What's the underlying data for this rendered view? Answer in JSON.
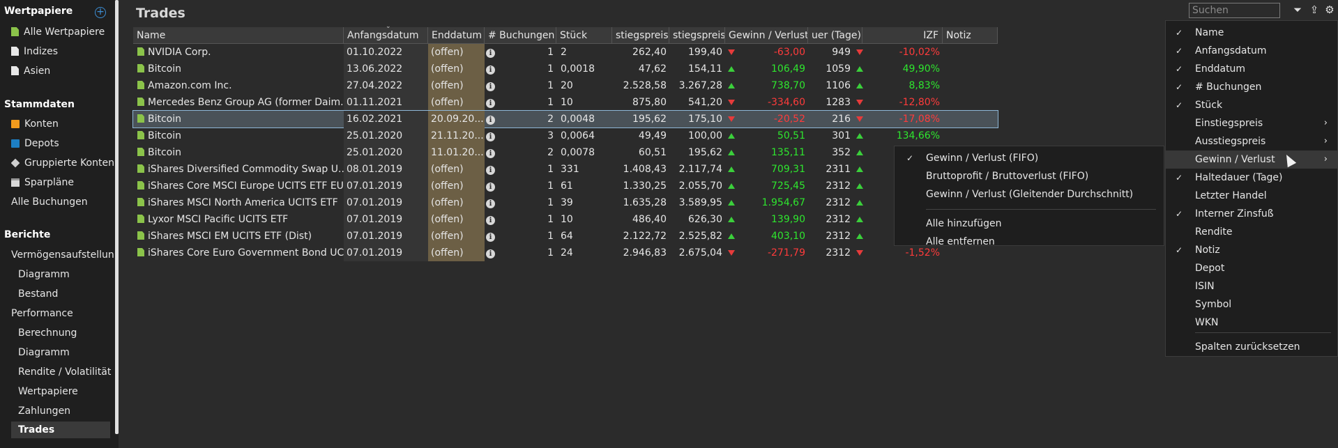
{
  "sidebar": {
    "sections": {
      "wertpapiere": "Wertpapiere",
      "stammdaten": "Stammdaten",
      "berichte": "Berichte"
    },
    "items": [
      {
        "label": "Alle Wertpapiere",
        "icon": "document-green-icon"
      },
      {
        "label": "Indizes",
        "icon": "document-white-icon"
      },
      {
        "label": "Asien",
        "icon": "document-white-icon"
      },
      {
        "label": "Konten",
        "icon": "account-orange-icon"
      },
      {
        "label": "Depots",
        "icon": "portfolio-blue-icon"
      },
      {
        "label": "Gruppierte Konten",
        "icon": "layers-icon"
      },
      {
        "label": "Sparpläne",
        "icon": "calendar-icon"
      },
      {
        "label": "Alle Buchungen"
      },
      {
        "label": "Vermögensaufstellung"
      },
      {
        "label": "Diagramm"
      },
      {
        "label": "Bestand"
      },
      {
        "label": "Performance"
      },
      {
        "label": "Berechnung"
      },
      {
        "label": "Diagramm"
      },
      {
        "label": "Rendite / Volatilität"
      },
      {
        "label": "Wertpapiere"
      },
      {
        "label": "Zahlungen"
      },
      {
        "label": "Trades"
      }
    ]
  },
  "page": {
    "title": "Trades",
    "search_placeholder": "Suchen"
  },
  "toolbar_icons": [
    "filter-icon",
    "export-icon",
    "settings-icon"
  ],
  "table": {
    "headers": [
      "Name",
      "Anfangsdatum",
      "Enddatum",
      "# Buchungen",
      "Stück",
      "stiegspreis",
      "stiegspreis",
      "Gewinn / Verlust",
      "uer (Tage)",
      "IZF",
      "Notiz"
    ],
    "rows": [
      {
        "name": "NVIDIA Corp.",
        "start": "01.10.2022",
        "end": "(offen)",
        "bookings": "1",
        "qty": "2",
        "entry": "262,40",
        "exit": "199,40",
        "pl_dir": "down",
        "pl": "-63,00",
        "days": "949",
        "izf_dir": "down",
        "izf": "-10,02%"
      },
      {
        "name": "Bitcoin",
        "start": "13.06.2022",
        "end": "(offen)",
        "bookings": "1",
        "qty": "0,0018",
        "entry": "47,62",
        "exit": "154,11",
        "pl_dir": "up",
        "pl": "106,49",
        "days": "1059",
        "izf_dir": "up",
        "izf": "49,90%"
      },
      {
        "name": "Amazon.com Inc.",
        "start": "27.04.2022",
        "end": "(offen)",
        "bookings": "1",
        "qty": "20",
        "entry": "2.528,58",
        "exit": "3.267,28",
        "pl_dir": "up",
        "pl": "738,70",
        "days": "1106",
        "izf_dir": "up",
        "izf": "8,83%"
      },
      {
        "name": "Mercedes Benz Group AG (former Daim...",
        "start": "01.11.2021",
        "end": "(offen)",
        "bookings": "1",
        "qty": "10",
        "entry": "875,80",
        "exit": "541,20",
        "pl_dir": "down",
        "pl": "-334,60",
        "days": "1283",
        "izf_dir": "down",
        "izf": "-12,80%"
      },
      {
        "name": "Bitcoin",
        "start": "16.02.2021",
        "end": "20.09.20...",
        "bookings": "2",
        "qty": "0,0048",
        "entry": "195,62",
        "exit": "175,10",
        "pl_dir": "down",
        "pl": "-20,52",
        "days": "216",
        "izf_dir": "down",
        "izf": "-17,08%"
      },
      {
        "name": "Bitcoin",
        "start": "25.01.2020",
        "end": "21.11.20...",
        "bookings": "3",
        "qty": "0,0064",
        "entry": "49,49",
        "exit": "100,00",
        "pl_dir": "up",
        "pl": "50,51",
        "days": "301",
        "izf_dir": "up",
        "izf": "134,66%"
      },
      {
        "name": "Bitcoin",
        "start": "25.01.2020",
        "end": "11.01.20...",
        "bookings": "2",
        "qty": "0,0078",
        "entry": "60,51",
        "exit": "195,62",
        "pl_dir": "up",
        "pl": "135,11",
        "days": "352",
        "izf_dir": "up",
        "izf": ""
      },
      {
        "name": "iShares Diversified Commodity Swap U...",
        "start": "08.01.2019",
        "end": "(offen)",
        "bookings": "1",
        "qty": "331",
        "entry": "1.408,43",
        "exit": "2.117,74",
        "pl_dir": "up",
        "pl": "709,31",
        "days": "2311",
        "izf_dir": "up",
        "izf": ""
      },
      {
        "name": "iShares Core MSCI Europe UCITS ETF EU...",
        "start": "07.01.2019",
        "end": "(offen)",
        "bookings": "1",
        "qty": "61",
        "entry": "1.330,25",
        "exit": "2.055,70",
        "pl_dir": "up",
        "pl": "725,45",
        "days": "2312",
        "izf_dir": "up",
        "izf": ""
      },
      {
        "name": "iShares MSCI North America UCITS ETF",
        "start": "07.01.2019",
        "end": "(offen)",
        "bookings": "1",
        "qty": "39",
        "entry": "1.635,28",
        "exit": "3.589,95",
        "pl_dir": "up",
        "pl": "1.954,67",
        "days": "2312",
        "izf_dir": "up",
        "izf": ""
      },
      {
        "name": "Lyxor MSCI Pacific UCITS ETF",
        "start": "07.01.2019",
        "end": "(offen)",
        "bookings": "1",
        "qty": "10",
        "entry": "486,40",
        "exit": "626,30",
        "pl_dir": "up",
        "pl": "139,90",
        "days": "2312",
        "izf_dir": "up",
        "izf": ""
      },
      {
        "name": "iShares MSCI EM UCITS ETF (Dist)",
        "start": "07.01.2019",
        "end": "(offen)",
        "bookings": "1",
        "qty": "64",
        "entry": "2.122,72",
        "exit": "2.525,82",
        "pl_dir": "up",
        "pl": "403,10",
        "days": "2312",
        "izf_dir": "up",
        "izf": ""
      },
      {
        "name": "iShares Core Euro Government Bond UC...",
        "start": "07.01.2019",
        "end": "(offen)",
        "bookings": "1",
        "qty": "24",
        "entry": "2.946,83",
        "exit": "2.675,04",
        "pl_dir": "down",
        "pl": "-271,79",
        "days": "2312",
        "izf_dir": "down",
        "izf": "-1,52%"
      }
    ]
  },
  "column_menu": [
    {
      "label": "Name",
      "checked": true
    },
    {
      "label": "Anfangsdatum",
      "checked": true
    },
    {
      "label": "Enddatum",
      "checked": true
    },
    {
      "label": "# Buchungen",
      "checked": true
    },
    {
      "label": "Stück",
      "checked": true
    },
    {
      "label": "Einstiegspreis",
      "checked": false,
      "submenu": true
    },
    {
      "label": "Ausstiegspreis",
      "checked": false,
      "submenu": true
    },
    {
      "label": "Gewinn / Verlust",
      "checked": false,
      "submenu": true
    },
    {
      "label": "Haltedauer (Tage)",
      "checked": true
    },
    {
      "label": "Letzter Handel",
      "checked": false
    },
    {
      "label": "Interner Zinsfuß",
      "checked": true
    },
    {
      "label": "Rendite",
      "checked": false
    },
    {
      "label": "Notiz",
      "checked": true
    },
    {
      "label": "Depot",
      "checked": false
    },
    {
      "label": "ISIN",
      "checked": false
    },
    {
      "label": "Symbol",
      "checked": false
    },
    {
      "label": "WKN",
      "checked": false
    },
    {
      "label": "Spalten zurücksetzen",
      "checked": false
    }
  ],
  "sub_menu": [
    {
      "label": "Gewinn / Verlust (FIFO)",
      "checked": true
    },
    {
      "label": "Bruttoprofit / Bruttoverlust (FIFO)",
      "checked": false
    },
    {
      "label": "Gewinn / Verlust (Gleitender Durchschnitt)",
      "checked": false
    },
    {
      "label": "Alle hinzufügen",
      "checked": false
    },
    {
      "label": "Alle entfernen",
      "checked": false
    }
  ],
  "colors": {
    "positive": "#2ee62e",
    "negative": "#ff3b3b",
    "enddate_highlight": "#6c5f45",
    "accent": "#3d8fd6"
  }
}
